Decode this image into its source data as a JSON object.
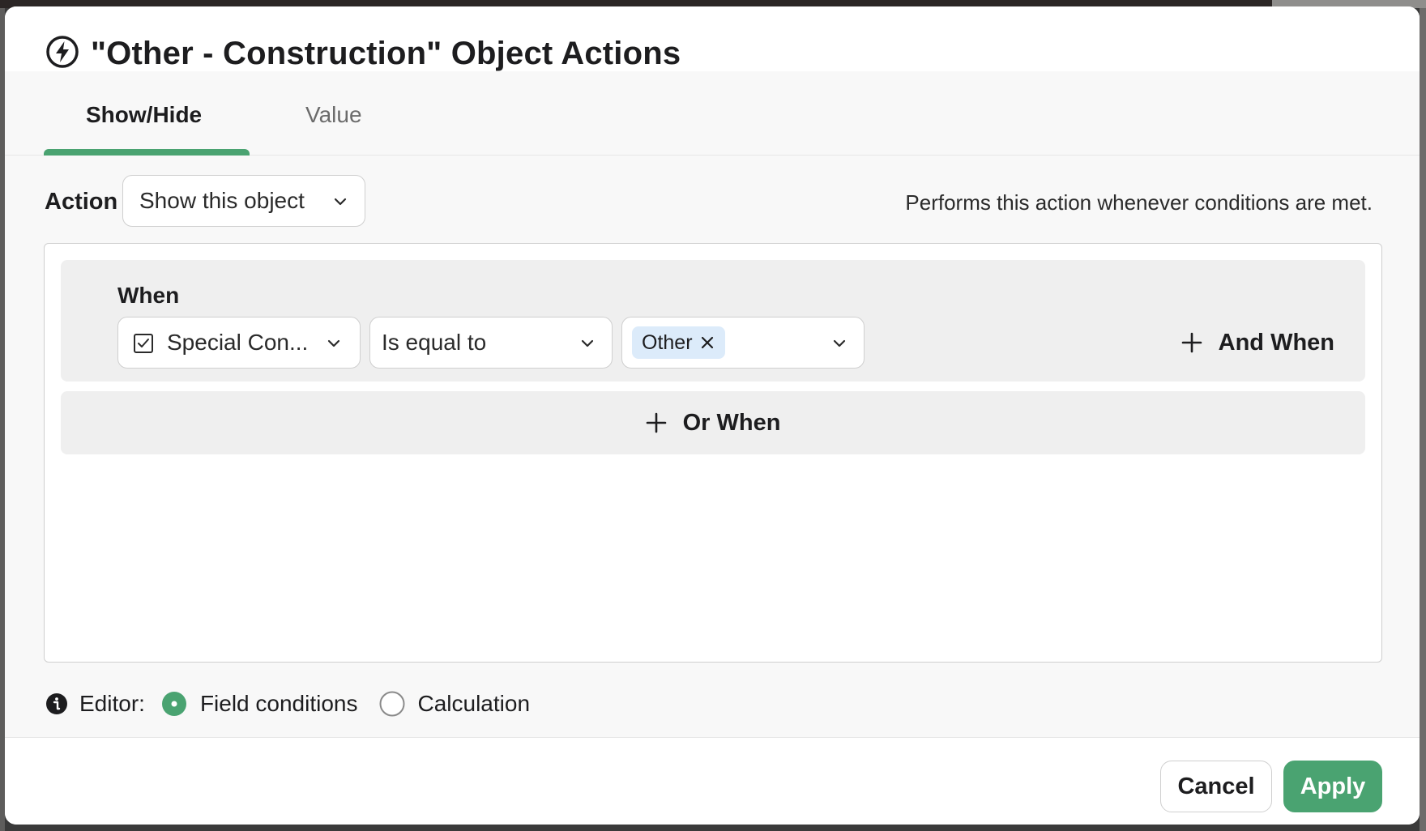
{
  "modal": {
    "title": "\"Other - Construction\" Object Actions"
  },
  "tabs": [
    {
      "label": "Show/Hide",
      "active": true
    },
    {
      "label": "Value",
      "active": false
    }
  ],
  "action": {
    "label": "Action",
    "selected": "Show this object",
    "hint": "Performs this action whenever conditions are met."
  },
  "condition": {
    "when_label": "When",
    "field": "Special Con...",
    "operator": "Is equal to",
    "value_tag": "Other",
    "and_when_label": "And When",
    "or_when_label": "Or When"
  },
  "editor": {
    "label": "Editor:",
    "options": [
      {
        "label": "Field conditions",
        "selected": true
      },
      {
        "label": "Calculation",
        "selected": false
      }
    ]
  },
  "footer": {
    "cancel_label": "Cancel",
    "apply_label": "Apply"
  },
  "colors": {
    "accent": "#4aa371",
    "tag_bg": "#dcebfa"
  },
  "icons": {
    "title": "lightning-bolt-icon",
    "field": "checkbox-icon",
    "info": "info-icon"
  }
}
